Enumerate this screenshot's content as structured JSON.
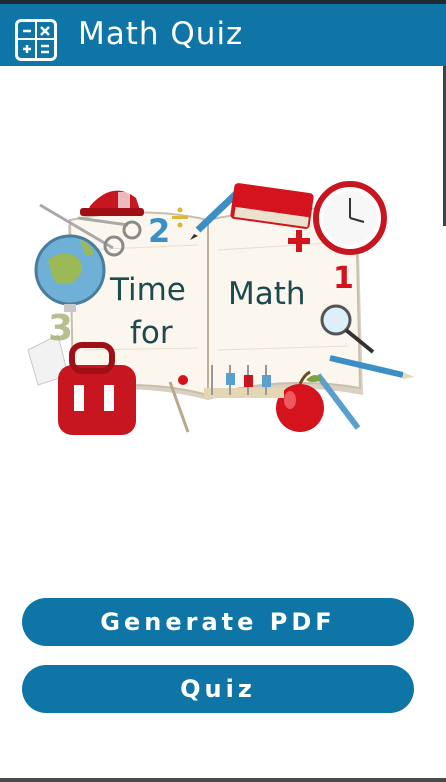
{
  "app_bar": {
    "icon": "calculator-icon",
    "title": "Math Quiz",
    "color": "#0f74a6"
  },
  "illustration": {
    "text_left_line1": "Time",
    "text_left_line2": "for",
    "text_right": "Math",
    "number_two": "2",
    "number_three": "3",
    "number_one": "1"
  },
  "buttons": {
    "generate_pdf": "Generate PDF",
    "quiz": "Quiz",
    "color": "#0f74a6"
  }
}
